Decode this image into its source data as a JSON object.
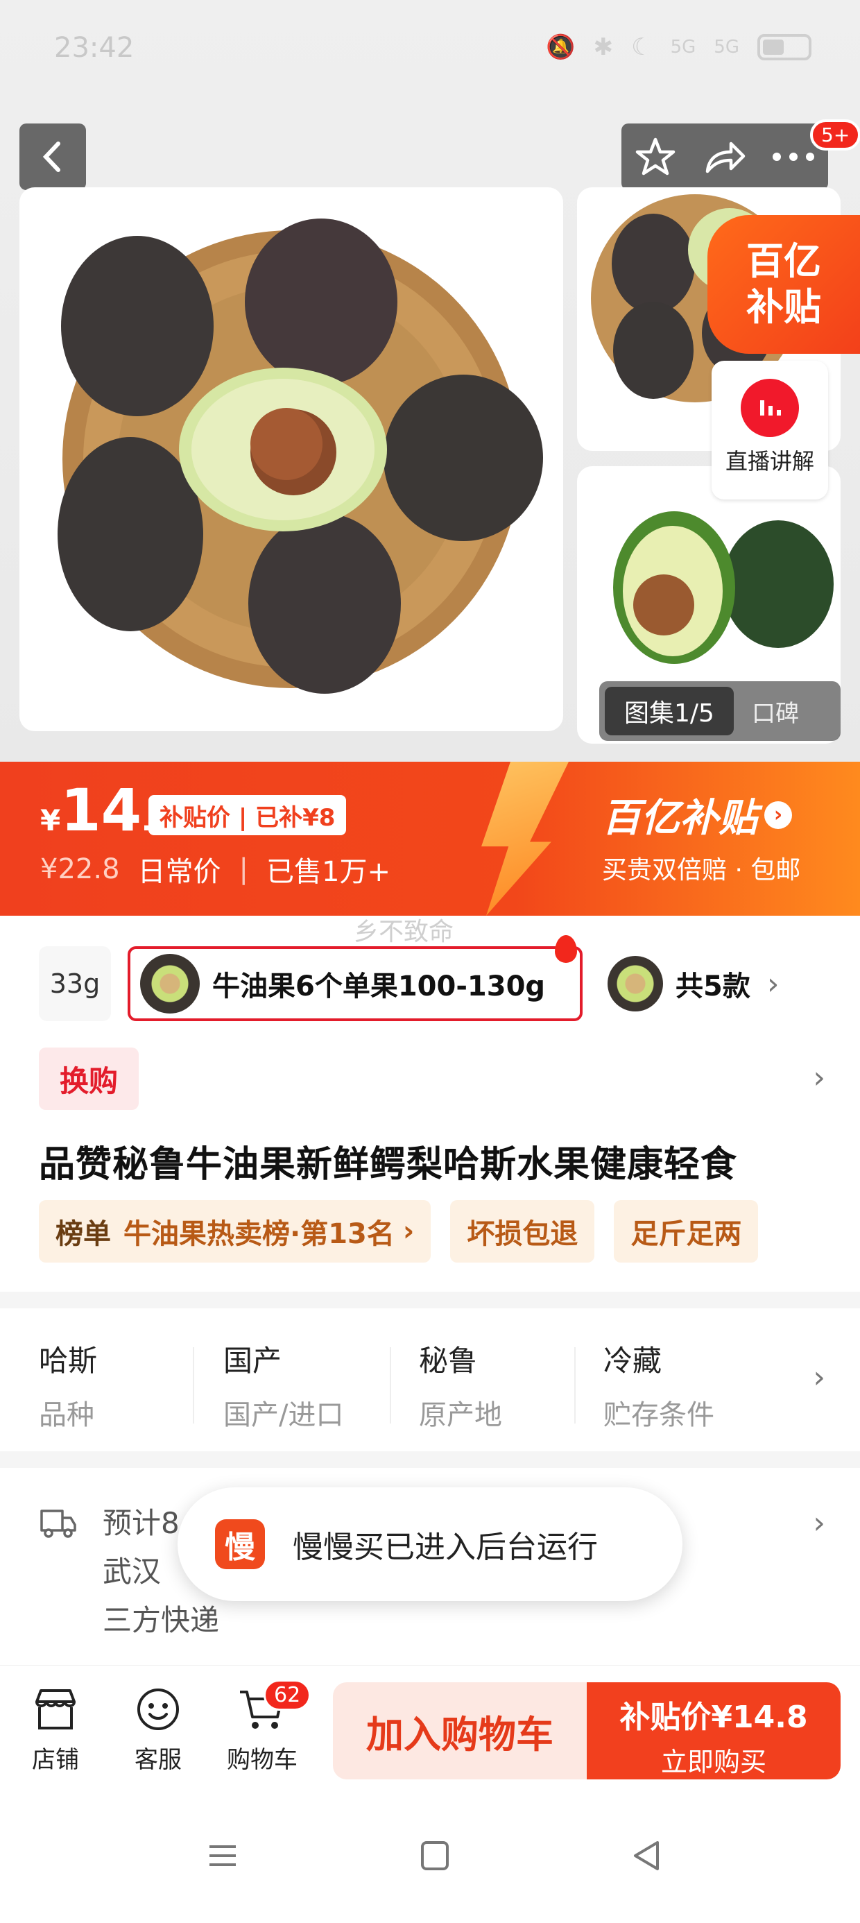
{
  "status_bar": {
    "time": "23:42",
    "signal_1": "5G",
    "signal_2": "5G"
  },
  "gallery": {
    "badge_count": "5+",
    "subsidy_corner": [
      "百亿",
      "补贴"
    ],
    "live_label": "直播讲解",
    "image_counter": "图集1/5",
    "review_label": "口碑"
  },
  "price": {
    "currency": "¥",
    "integer": "14",
    "decimal": ".8",
    "subsidy_tag": "补贴价 | 已补¥8",
    "original": "¥22.8",
    "daily_label": "日常价",
    "sold": "已售1万+",
    "brand": "百亿补贴",
    "brand_sub": "买贵双倍赔 · 包邮"
  },
  "watermark": "乡不致命",
  "sku": {
    "left_label": "33g",
    "selected_label": "牛油果6个单果100-130g",
    "more_label": "共5款"
  },
  "exchange_tag": "换购",
  "product_title": "品赞秘鲁牛油果新鲜鳄梨哈斯水果健康轻食",
  "tags": {
    "rank_title": "榜单",
    "rank_text": "牛油果热卖榜·第13名",
    "tag_2": "坏损包退",
    "tag_3": "足斤足两"
  },
  "specs": [
    {
      "value": "哈斯",
      "key": "品种"
    },
    {
      "value": "国产",
      "key": "国产/进口"
    },
    {
      "value": "秘鲁",
      "key": "原产地"
    },
    {
      "value": "冷藏",
      "key": "贮存条件"
    }
  ],
  "delivery": {
    "line_1": "预计8",
    "line_2": "武汉",
    "line_3": "三方快递"
  },
  "toast": {
    "icon_text": "慢",
    "message": "慢慢买已进入后台运行"
  },
  "bottom_bar": {
    "shop": "店铺",
    "service": "客服",
    "cart": "购物车",
    "cart_badge": "62",
    "add_to_cart": "加入购物车",
    "buy_price": "补贴价¥14.8",
    "buy_now": "立即购买"
  }
}
